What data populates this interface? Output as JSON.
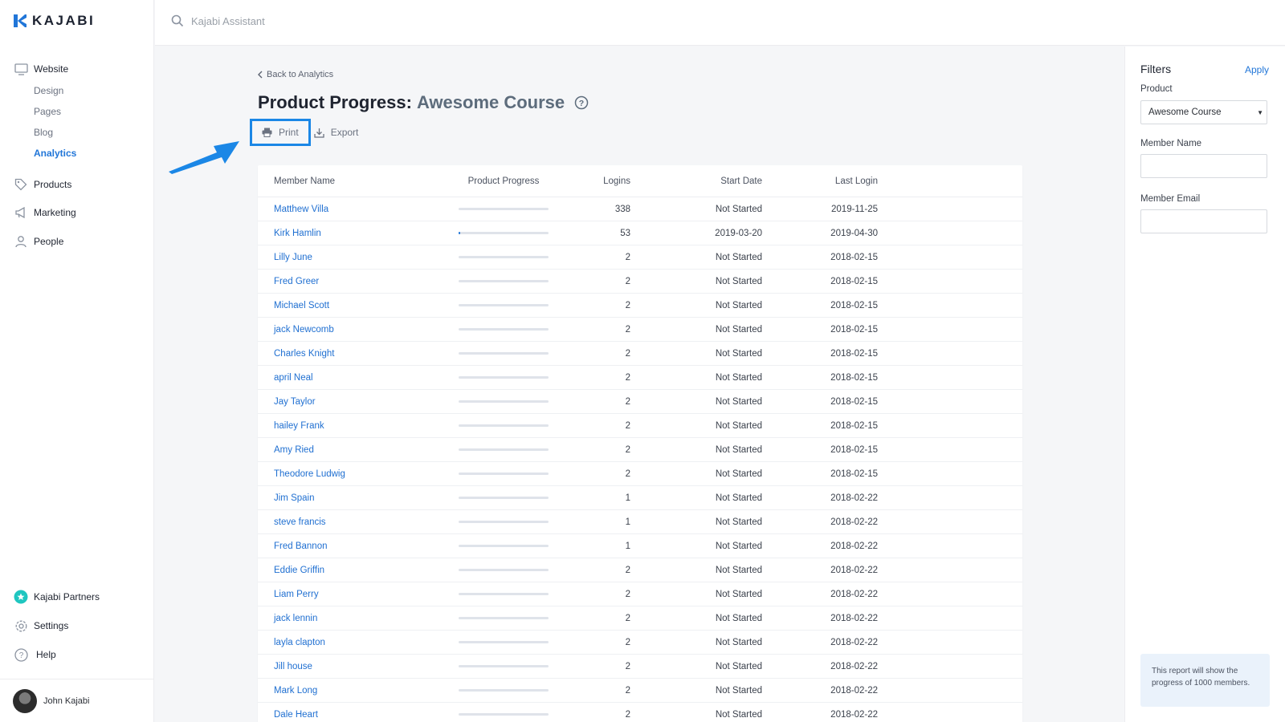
{
  "brand": {
    "name": "KAJABI"
  },
  "sidebar": {
    "website": {
      "label": "Website",
      "sub": [
        "Design",
        "Pages",
        "Blog",
        "Analytics"
      ],
      "active": "Analytics"
    },
    "items": [
      "Products",
      "Marketing",
      "People"
    ],
    "bottom": [
      "Kajabi Partners",
      "Settings",
      "Help"
    ],
    "user": "John Kajabi"
  },
  "search": {
    "placeholder": "Kajabi Assistant"
  },
  "page": {
    "back_label": "Back to Analytics",
    "title": "Product Progress:",
    "product": "Awesome Course",
    "print_label": "Print",
    "export_label": "Export"
  },
  "table": {
    "columns": [
      "Member Name",
      "Product Progress",
      "Logins",
      "Start Date",
      "Last Login"
    ],
    "rows": [
      {
        "name": "Matthew Villa",
        "progress": 0,
        "logins": "338",
        "start": "Not Started",
        "last": "2019-11-25"
      },
      {
        "name": "Kirk Hamlin",
        "progress": 0.02,
        "logins": "53",
        "start": "2019-03-20",
        "last": "2019-04-30"
      },
      {
        "name": "Lilly June",
        "progress": 0,
        "logins": "2",
        "start": "Not Started",
        "last": "2018-02-15"
      },
      {
        "name": "Fred Greer",
        "progress": 0,
        "logins": "2",
        "start": "Not Started",
        "last": "2018-02-15"
      },
      {
        "name": "Michael Scott",
        "progress": 0,
        "logins": "2",
        "start": "Not Started",
        "last": "2018-02-15"
      },
      {
        "name": "jack Newcomb",
        "progress": 0,
        "logins": "2",
        "start": "Not Started",
        "last": "2018-02-15"
      },
      {
        "name": "Charles Knight",
        "progress": 0,
        "logins": "2",
        "start": "Not Started",
        "last": "2018-02-15"
      },
      {
        "name": "april Neal",
        "progress": 0,
        "logins": "2",
        "start": "Not Started",
        "last": "2018-02-15"
      },
      {
        "name": "Jay Taylor",
        "progress": 0,
        "logins": "2",
        "start": "Not Started",
        "last": "2018-02-15"
      },
      {
        "name": "hailey Frank",
        "progress": 0,
        "logins": "2",
        "start": "Not Started",
        "last": "2018-02-15"
      },
      {
        "name": "Amy Ried",
        "progress": 0,
        "logins": "2",
        "start": "Not Started",
        "last": "2018-02-15"
      },
      {
        "name": "Theodore Ludwig",
        "progress": 0,
        "logins": "2",
        "start": "Not Started",
        "last": "2018-02-15"
      },
      {
        "name": "Jim Spain",
        "progress": 0,
        "logins": "1",
        "start": "Not Started",
        "last": "2018-02-22"
      },
      {
        "name": "steve francis",
        "progress": 0,
        "logins": "1",
        "start": "Not Started",
        "last": "2018-02-22"
      },
      {
        "name": "Fred Bannon",
        "progress": 0,
        "logins": "1",
        "start": "Not Started",
        "last": "2018-02-22"
      },
      {
        "name": "Eddie Griffin",
        "progress": 0,
        "logins": "2",
        "start": "Not Started",
        "last": "2018-02-22"
      },
      {
        "name": "Liam Perry",
        "progress": 0,
        "logins": "2",
        "start": "Not Started",
        "last": "2018-02-22"
      },
      {
        "name": "jack lennin",
        "progress": 0,
        "logins": "2",
        "start": "Not Started",
        "last": "2018-02-22"
      },
      {
        "name": "layla clapton",
        "progress": 0,
        "logins": "2",
        "start": "Not Started",
        "last": "2018-02-22"
      },
      {
        "name": "Jill house",
        "progress": 0,
        "logins": "2",
        "start": "Not Started",
        "last": "2018-02-22"
      },
      {
        "name": "Mark Long",
        "progress": 0,
        "logins": "2",
        "start": "Not Started",
        "last": "2018-02-22"
      },
      {
        "name": "Dale Heart",
        "progress": 0,
        "logins": "2",
        "start": "Not Started",
        "last": "2018-02-22"
      }
    ]
  },
  "filters": {
    "title": "Filters",
    "apply": "Apply",
    "product_label": "Product",
    "product_value": "Awesome Course",
    "member_name_label": "Member Name",
    "member_email_label": "Member Email",
    "note": "This report will show the progress of 1000 members."
  },
  "colors": {
    "accent": "#2176d8",
    "highlight": "#1b87e6",
    "partners_badge": "#1fc6c0"
  }
}
